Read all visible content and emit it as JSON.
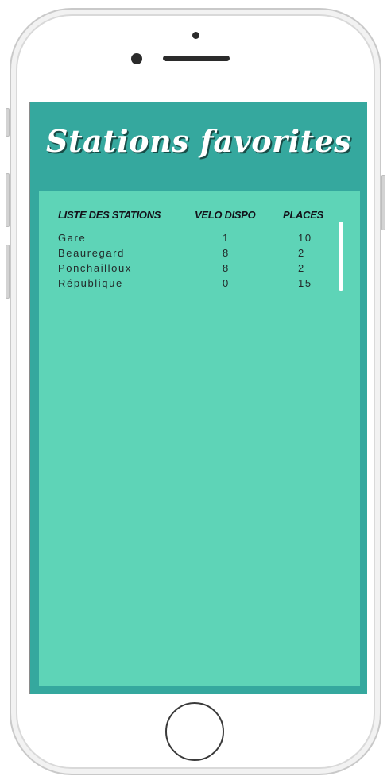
{
  "app": {
    "title": "Stations favorites"
  },
  "table": {
    "headers": {
      "station": "LISTE DES STATIONS",
      "velo": "VELO DISPO",
      "places": "PLACES"
    },
    "rows": [
      {
        "station": "Gare",
        "velo": "1",
        "places": "10"
      },
      {
        "station": "Beauregard",
        "velo": "8",
        "places": "2"
      },
      {
        "station": "Ponchailloux",
        "velo": "8",
        "places": "2"
      },
      {
        "station": "République",
        "velo": "0",
        "places": "15"
      }
    ]
  },
  "colors": {
    "header_background": "#35a89e",
    "panel_background": "#5ed4b7",
    "title_text": "#ffffff",
    "table_text": "#222a2a"
  }
}
